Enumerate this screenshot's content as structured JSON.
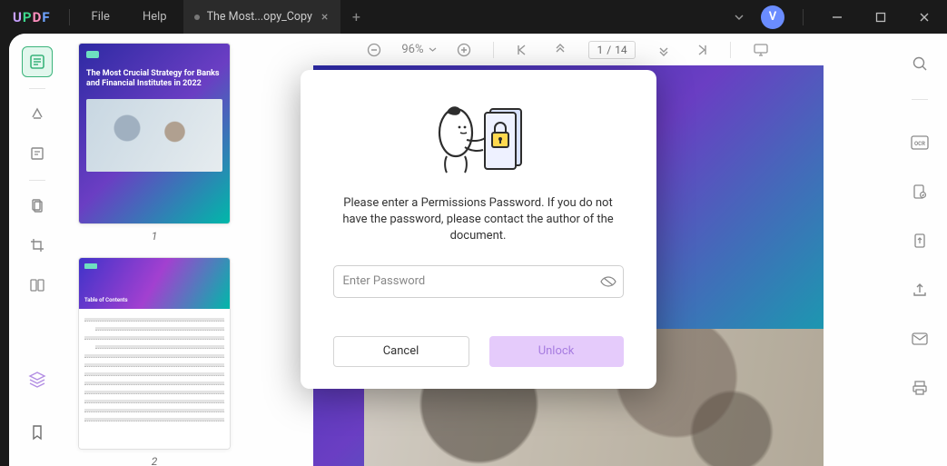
{
  "app": {
    "logo_chars": {
      "u": "U",
      "p": "P",
      "d": "D",
      "f": "F"
    },
    "menu": {
      "file": "File",
      "help": "Help"
    }
  },
  "tab": {
    "title": "The Most...opy_Copy",
    "close_glyph": "×",
    "newtab_glyph": "+"
  },
  "avatar": {
    "initial": "V"
  },
  "toolbar": {
    "zoom_value": "96%",
    "page_current": "1",
    "page_sep": "/",
    "page_total": "14"
  },
  "thumbnails": {
    "page1_num": "1",
    "page2_num": "2",
    "p1_heading": "The Most Crucial Strategy for Banks and Financial Institutes in 2022",
    "p1_sub": "",
    "p2_toc": "Table of Contents"
  },
  "modal": {
    "text": "Please enter a Permissions Password. If you do not have the password, please contact the author of the document.",
    "placeholder": "Enter Password",
    "cancel": "Cancel",
    "unlock": "Unlock"
  }
}
